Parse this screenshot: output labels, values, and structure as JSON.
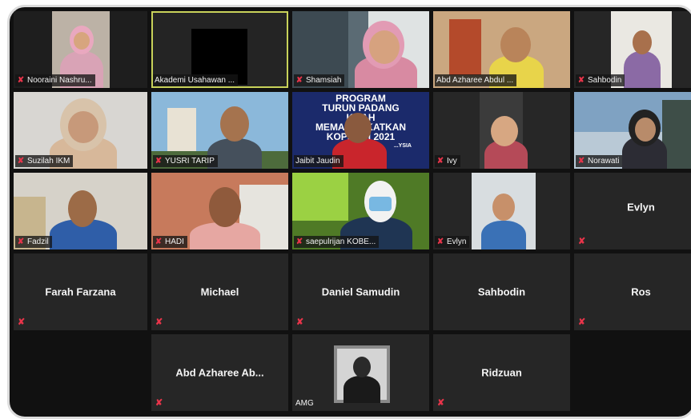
{
  "participants": [
    {
      "name": "Nooraini Nashru...",
      "muted": true
    },
    {
      "name": "Akademi Usahawan ...",
      "muted": false,
      "active_speaker": true
    },
    {
      "name": "Shamsiah",
      "muted": true
    },
    {
      "name": "Abd Azharee Abdul ...",
      "muted": false
    },
    {
      "name": "Sahbodin",
      "muted": true
    },
    {
      "name": "Suzilah IKM",
      "muted": true
    },
    {
      "name": "YUSRI TARIP",
      "muted": true
    },
    {
      "name": "Jaibit Jaudin",
      "muted": false
    },
    {
      "name": "Ivy",
      "muted": true
    },
    {
      "name": "Norawati",
      "muted": true
    },
    {
      "name": "Fadzil",
      "muted": true
    },
    {
      "name": "HADI",
      "muted": true
    },
    {
      "name": "saepulrijan KOBE...",
      "muted": true
    },
    {
      "name": "Evlyn",
      "muted": true
    },
    {
      "name": "Evlyn",
      "muted": true,
      "video_off": true
    },
    {
      "name": "Farah Farzana",
      "muted": true,
      "video_off": true
    },
    {
      "name": "Michael",
      "muted": true,
      "video_off": true
    },
    {
      "name": "Daniel Samudin",
      "muted": true,
      "video_off": true
    },
    {
      "name": "Sahbodin",
      "muted": true,
      "video_off": true
    },
    {
      "name": "Ros",
      "muted": true,
      "video_off": true
    },
    {
      "name": "Abd Azharee Ab...",
      "muted": true,
      "video_off": true
    },
    {
      "name": "AMG",
      "muted": false
    },
    {
      "name": "Ridzuan",
      "muted": true,
      "video_off": true
    }
  ],
  "banner_text": {
    "line1": "PROGRAM",
    "line2": "TURUN PADANG",
    "line3": "K...AH",
    "line4": "MEMAS...AKATKAN",
    "line5": "KOPE...SI 2021",
    "line6": "...YSIA"
  },
  "mic_muted_icon": "microphone-muted-icon",
  "colors": {
    "active_outline": "#c8d25a",
    "muted_mic": "#e8344a",
    "tile_bg": "#262626"
  }
}
